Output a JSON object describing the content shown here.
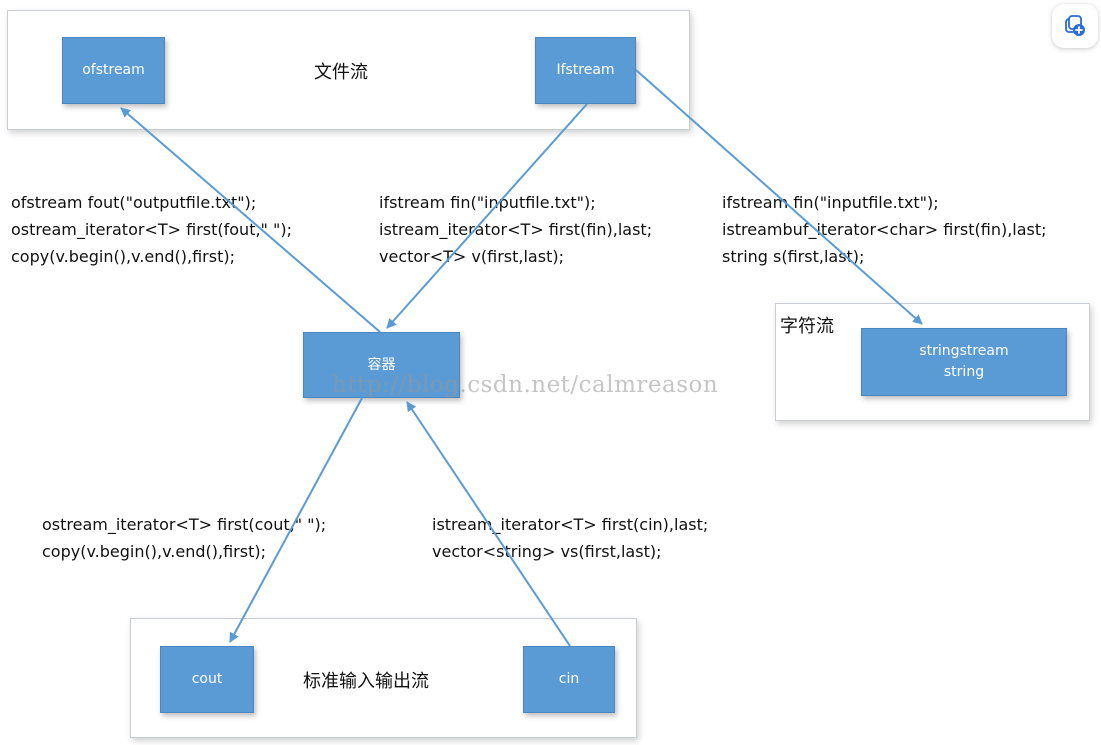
{
  "groups": {
    "file_stream": "文件流",
    "char_stream": "字符流",
    "std_io_stream": "标准输入输出流"
  },
  "nodes": {
    "ofstream": "ofstream",
    "ifstream": "Ifstream",
    "container": "容器",
    "stringstream": "stringstream",
    "string": "string",
    "cout": "cout",
    "cin": "cin"
  },
  "code": {
    "container_to_ofstream": [
      "ofstream fout(\"outputfile.txt\");",
      "ostream_iterator<T> first(fout,\" \");",
      "copy(v.begin(),v.end(),first);"
    ],
    "ifstream_to_container": [
      "ifstream fin(\"inputfile.txt\");",
      "istream_iterator<T> first(fin),last;",
      "vector<T> v(first,last);"
    ],
    "ifstream_to_stringstream": [
      "ifstream fin(\"inputfile.txt\");",
      "istreambuf_iterator<char> first(fin),last;",
      "string s(first,last);"
    ],
    "container_to_cout": [
      "ostream_iterator<T> first(cout,\" \");",
      "copy(v.begin(),v.end(),first);"
    ],
    "cin_to_container": [
      "istream_iterator<T> first(cin),last;",
      "vector<string> vs(first,last);"
    ]
  },
  "watermark": "http://blog.csdn.net/calmreason",
  "icons": {
    "collect": "collection-add-icon"
  },
  "colors": {
    "node_fill": "#5b9bd5",
    "arrow": "#5b9bd5",
    "group_border": "#c8cdd3"
  }
}
